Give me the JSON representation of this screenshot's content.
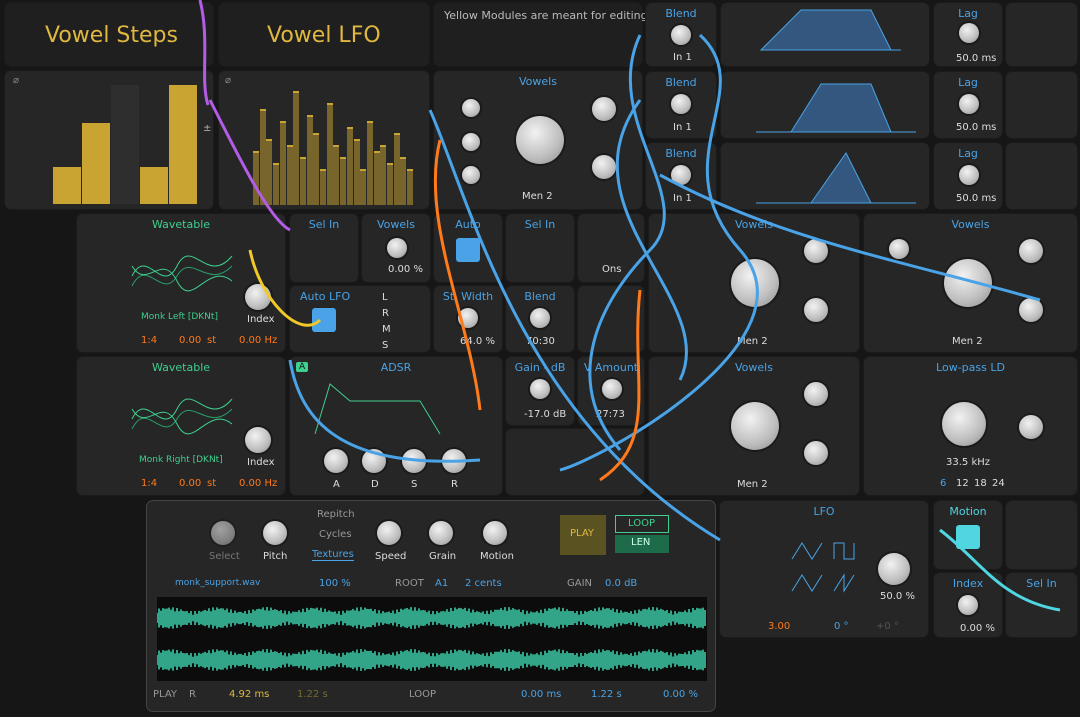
{
  "header": {
    "vowel_steps": "Vowel Steps",
    "vowel_lfo": "Vowel LFO",
    "note": "Yellow Modules are meant for editing"
  },
  "blend": [
    {
      "title": "Blend",
      "sub": "In 1"
    },
    {
      "title": "Blend",
      "sub": "In 1"
    },
    {
      "title": "Blend",
      "sub": "In 1"
    }
  ],
  "lag": [
    {
      "title": "Lag",
      "val": "50.0 ms"
    },
    {
      "title": "Lag",
      "val": "50.0 ms"
    },
    {
      "title": "Lag",
      "val": "50.0 ms"
    }
  ],
  "vowels_top": {
    "title": "Vowels",
    "preset": "Men 2"
  },
  "wavetable1": {
    "title": "Wavetable",
    "name": "Monk Left [DKNt]",
    "ratio": "1:4",
    "st": "0.00",
    "st_unit": "st",
    "hz": "0.00 Hz",
    "index": "Index"
  },
  "wavetable2": {
    "title": "Wavetable",
    "name": "Monk Right [DKNt]",
    "ratio": "1:4",
    "st": "0.00",
    "st_unit": "st",
    "hz": "0.00 Hz",
    "index": "Index"
  },
  "selin1": "Sel In",
  "vowels_mid": {
    "title": "Vowels",
    "pct": "0.00 %"
  },
  "auto": "Auto",
  "selin2": "Sel In",
  "ons": "Ons",
  "auto_lfo": {
    "title": "Auto LFO",
    "L": "L",
    "R": "R",
    "M": "M",
    "S": "S"
  },
  "stwidth": {
    "title": "St. Width",
    "val": "64.0 %"
  },
  "blend2": {
    "title": "Blend",
    "val": "70:30"
  },
  "vowels_r1": {
    "title": "Vowels",
    "preset": "Men 2"
  },
  "vowels_r2": {
    "title": "Vowels",
    "preset": "Men 2"
  },
  "adsr": {
    "title": "ADSR",
    "a": "A",
    "d": "D",
    "s": "S",
    "r": "R",
    "badge": "A"
  },
  "gain": {
    "title": "Gain - dB",
    "val": "-17.0 dB"
  },
  "vamount": {
    "title": "V Amount",
    "val": "27:73"
  },
  "vowels_r3": {
    "title": "Vowels",
    "preset": "Men 2"
  },
  "lowpass": {
    "title": "Low-pass LD",
    "freq": "33.5 kHz",
    "slopes": [
      "6",
      "12",
      "18",
      "24"
    ]
  },
  "sampler": {
    "repitch": "Repitch",
    "cycles": "Cycles",
    "textures": "Textures",
    "select": "Select",
    "pitch": "Pitch",
    "speed": "Speed",
    "grain": "Grain",
    "motion": "Motion",
    "play": "PLAY",
    "loop": "LOOP",
    "len": "LEN",
    "file": "monk_support.wav",
    "pct": "100 %",
    "root_lbl": "ROOT",
    "root": "A1",
    "cents": "2 cents",
    "gain_lbl": "GAIN",
    "gain": "0.0 dB",
    "play2": "PLAY",
    "r": "R",
    "ms1": "4.92 ms",
    "s1": "1.22 s",
    "loop2": "LOOP",
    "ms2": "0.00 ms",
    "s2": "1.22 s",
    "pct2": "0.00 %"
  },
  "lfo": {
    "title": "LFO",
    "rate": "3.00",
    "phase": "0 °",
    "phase2": "+0 °",
    "amt": "50.0 %"
  },
  "motion": "Motion",
  "index2": {
    "title": "Index",
    "val": "0.00 %"
  },
  "selin3": "Sel In",
  "steps": [
    0.3,
    0.65,
    0.95,
    0.3,
    0.95
  ],
  "lfo_bars": [
    0.45,
    0.8,
    0.55,
    0.35,
    0.7,
    0.5,
    0.95,
    0.4,
    0.75,
    0.6,
    0.3,
    0.85,
    0.5,
    0.4,
    0.65,
    0.55,
    0.3,
    0.7,
    0.45,
    0.5,
    0.35,
    0.6,
    0.4,
    0.3
  ]
}
